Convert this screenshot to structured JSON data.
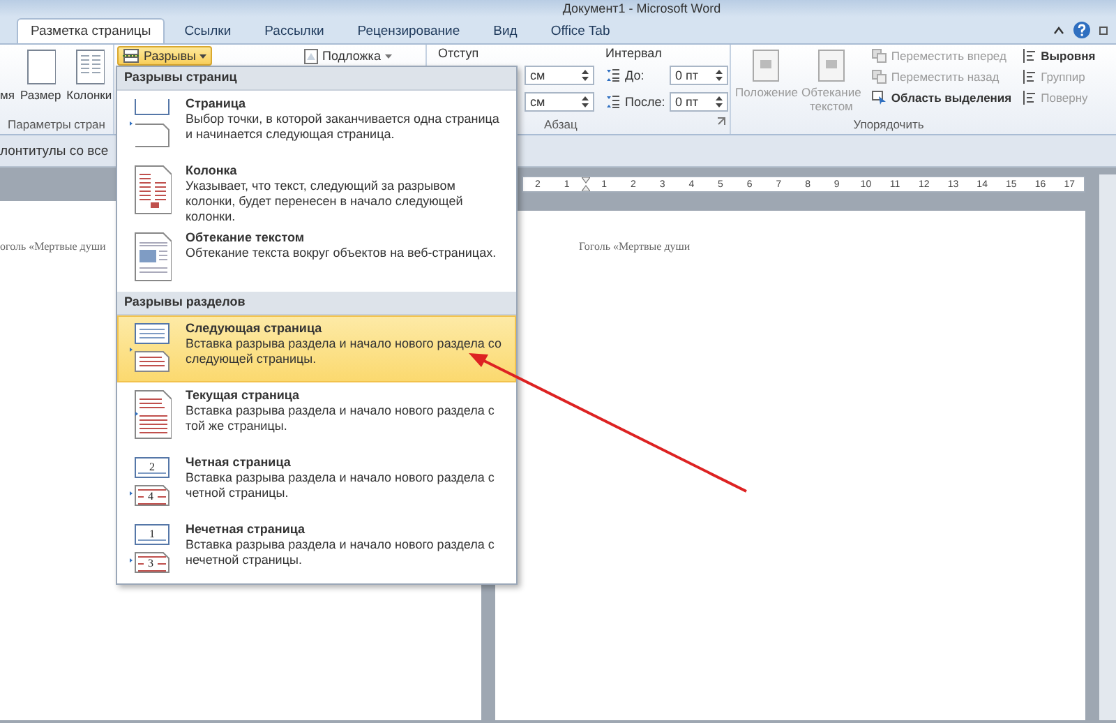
{
  "window": {
    "title": "Документ1 - Microsoft Word"
  },
  "tabs": [
    {
      "label": "Разметка страницы",
      "selected": true
    },
    {
      "label": "Ссылки",
      "selected": false
    },
    {
      "label": "Рассылки",
      "selected": false
    },
    {
      "label": "Рецензирование",
      "selected": false
    },
    {
      "label": "Вид",
      "selected": false
    },
    {
      "label": "Office Tab",
      "selected": false
    }
  ],
  "ribbon": {
    "page_setup": {
      "buttons": [
        "мя",
        "Размер",
        "Колонки"
      ],
      "group_label": "Параметры стран"
    },
    "breaks_button": {
      "label": "Разрывы",
      "pressed": true
    },
    "watermark_button": {
      "label": "Подложка"
    },
    "indent": {
      "label": "Отступ",
      "fields": [
        {
          "value": "см"
        },
        {
          "value": "см"
        }
      ]
    },
    "spacing": {
      "label": "Интервал",
      "fields": [
        {
          "label": "До:",
          "value": "0 пт"
        },
        {
          "label": "После:",
          "value": "0 пт"
        }
      ]
    },
    "paragraph_group_label": "Абзац",
    "arrange": {
      "large_buttons": [
        {
          "label": "Положение",
          "disabled": true
        },
        {
          "label": "Обтекание текстом",
          "disabled": true
        }
      ],
      "small_buttons": [
        {
          "label": "Переместить вперед",
          "disabled": true
        },
        {
          "label": "Переместить назад",
          "disabled": true
        },
        {
          "label": "Область выделения",
          "disabled": false
        }
      ],
      "right_buttons": [
        {
          "label": "Выровня",
          "disabled": false
        },
        {
          "label": "Группир",
          "disabled": true
        },
        {
          "label": "Поверну",
          "disabled": true
        }
      ],
      "group_label": "Упорядочить"
    }
  },
  "infobar": {
    "text": "лонтитулы со все"
  },
  "ruler": {
    "labels": [
      "2",
      "1",
      "1",
      "2",
      "3",
      "4",
      "5",
      "6",
      "7",
      "8",
      "9",
      "10",
      "11",
      "12",
      "13",
      "14",
      "15",
      "16",
      "17"
    ]
  },
  "pages": [
    {
      "header": "оголь «Мертвые души"
    },
    {
      "header": "Гоголь «Мертвые души"
    }
  ],
  "menu": {
    "sections": [
      {
        "title": "Разрывы страниц",
        "items": [
          {
            "kind": "page",
            "title": "Страница",
            "description": "Выбор точки, в которой заканчивается одна страница и начинается следующая страница.",
            "selected": false
          },
          {
            "kind": "column",
            "title": "Колонка",
            "description": "Указывает, что текст, следующий за разрывом колонки, будет перенесен в начало следующей колонки.",
            "selected": false
          },
          {
            "kind": "wrap",
            "title": "Обтекание текстом",
            "description": "Обтекание текста вокруг объектов на веб-страницах.",
            "selected": false
          }
        ]
      },
      {
        "title": "Разрывы разделов",
        "items": [
          {
            "kind": "next",
            "title": "Следующая страница",
            "description": "Вставка разрыва раздела и начало нового раздела со следующей страницы.",
            "selected": true
          },
          {
            "kind": "continuous",
            "title": "Текущая страница",
            "description": "Вставка разрыва раздела и начало нового раздела с той же страницы.",
            "selected": false
          },
          {
            "kind": "numbered",
            "title": "Четная страница",
            "description": "Вставка разрыва раздела и начало нового раздела с четной страницы.",
            "icon_numbers": [
              "2",
              "4"
            ],
            "selected": false
          },
          {
            "kind": "numbered",
            "title": "Нечетная страница",
            "description": "Вставка разрыва раздела и начало нового раздела с нечетной страницы.",
            "icon_numbers": [
              "1",
              "3"
            ],
            "selected": false
          }
        ]
      }
    ]
  }
}
